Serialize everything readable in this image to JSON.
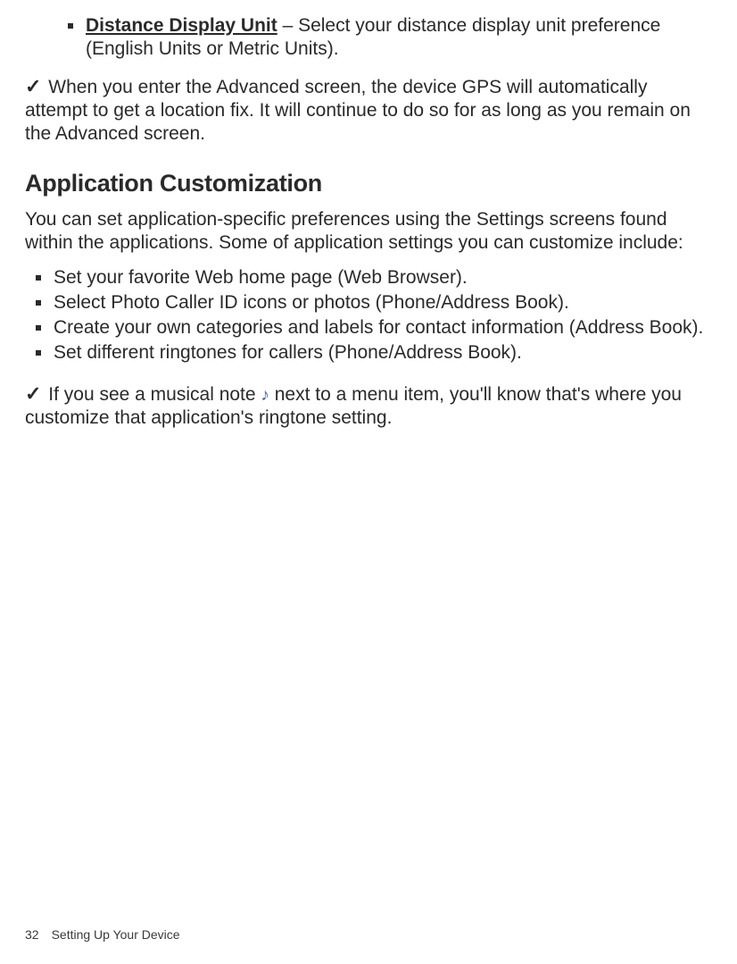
{
  "nestedItem": {
    "title": "Distance Display Unit",
    "desc": " – Select your distance display unit preference (English Units or Metric Units)."
  },
  "tip1": " When you enter the Advanced screen, the device GPS will automatically attempt to get a location fix. It will continue to do so for as long as you remain on the Advanced screen.",
  "heading": "Application Customization",
  "intro": "You can set application-specific preferences using the Settings screens found within the applications. Some of application settings you can customize include:",
  "mainList": [
    "Set your favorite Web home page (Web Browser).",
    "Select Photo Caller ID icons or photos (Phone/Address Book).",
    "Create your own categories and labels for contact information (Address Book).",
    "Set different ringtones for callers (Phone/Address Book)."
  ],
  "tip2a": "  If you see a musical note ",
  "tip2b": " next to a menu item, you'll know that's where you customize that application's ringtone setting.",
  "footer": {
    "page": "32",
    "section": "Setting Up Your Device"
  }
}
